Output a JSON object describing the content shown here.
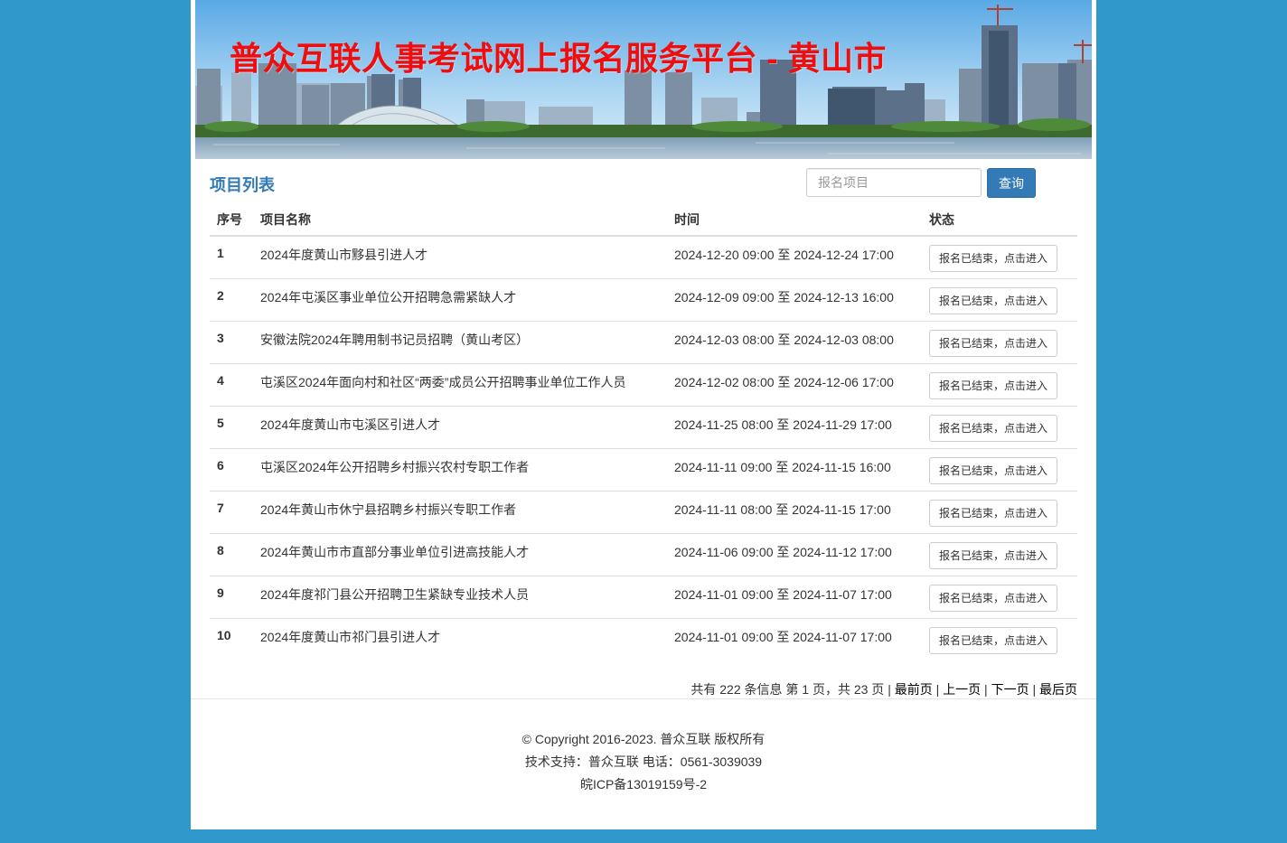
{
  "banner": {
    "title": "普众互联人事考试网上报名服务平台 - 黄山市"
  },
  "main": {
    "section_title": "项目列表",
    "search": {
      "placeholder": "报名项目",
      "value": ""
    },
    "search_button": "查询",
    "table": {
      "headers": [
        "序号",
        "项目名称",
        "时间",
        "状态"
      ],
      "rows": [
        {
          "no": "1",
          "name": "2024年度黄山市黟县引进人才",
          "time": "2024-12-20 09:00 至 2024-12-24 17:00",
          "status": "报名已结束，点击进入"
        },
        {
          "no": "2",
          "name": "2024年屯溪区事业单位公开招聘急需紧缺人才",
          "time": "2024-12-09 09:00 至 2024-12-13 16:00",
          "status": "报名已结束，点击进入"
        },
        {
          "no": "3",
          "name": "安徽法院2024年聘用制书记员招聘（黄山考区）",
          "time": "2024-12-03 08:00 至 2024-12-03 08:00",
          "status": "报名已结束，点击进入"
        },
        {
          "no": "4",
          "name": "屯溪区2024年面向村和社区“两委”成员公开招聘事业单位工作人员",
          "time": "2024-12-02 08:00 至 2024-12-06 17:00",
          "status": "报名已结束，点击进入"
        },
        {
          "no": "5",
          "name": "2024年度黄山市屯溪区引进人才",
          "time": "2024-11-25 08:00 至 2024-11-29 17:00",
          "status": "报名已结束，点击进入"
        },
        {
          "no": "6",
          "name": "屯溪区2024年公开招聘乡村振兴农村专职工作者",
          "time": "2024-11-11 09:00 至 2024-11-15 16:00",
          "status": "报名已结束，点击进入"
        },
        {
          "no": "7",
          "name": "2024年黄山市休宁县招聘乡村振兴专职工作者",
          "time": "2024-11-11 08:00 至 2024-11-15 17:00",
          "status": "报名已结束，点击进入"
        },
        {
          "no": "8",
          "name": "2024年黄山市市直部分事业单位引进高技能人才",
          "time": "2024-11-06 09:00 至 2024-11-12 17:00",
          "status": "报名已结束，点击进入"
        },
        {
          "no": "9",
          "name": "2024年度祁门县公开招聘卫生紧缺专业技术人员",
          "time": "2024-11-01 09:00 至 2024-11-07 17:00",
          "status": "报名已结束，点击进入"
        },
        {
          "no": "10",
          "name": "2024年度黄山市祁门县引进人才",
          "time": "2024-11-01 09:00 至 2024-11-07 17:00",
          "status": "报名已结束，点击进入"
        }
      ]
    },
    "pager": {
      "summary": "共有 222 条信息 第 1 页，共 23 页",
      "sep": "|",
      "first": "最前页",
      "prev": "上一页",
      "next": "下一页",
      "last": "最后页"
    }
  },
  "footer": {
    "copyright": "© Copyright 2016-2023. 普众互联 版权所有",
    "support": "技术支持：普众互联 电话：0561-3039039",
    "icp": "皖ICP备13019159号-2"
  },
  "colors": {
    "background": "#3098cb",
    "title_red": "#f00d0d",
    "accent_blue": "#337ab7"
  }
}
